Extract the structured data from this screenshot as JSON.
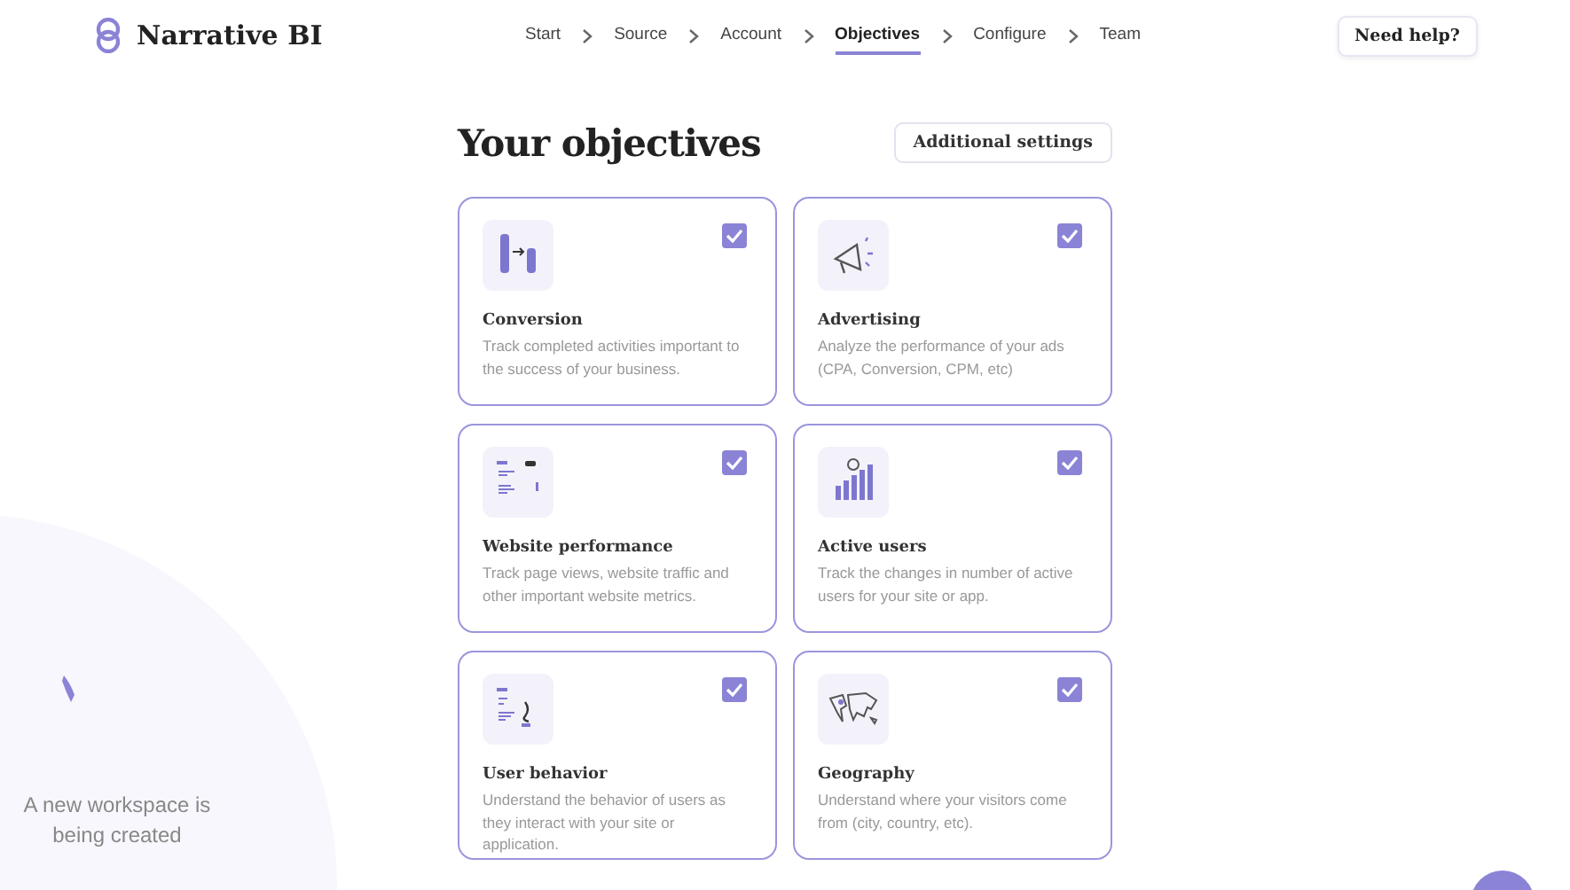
{
  "brand": {
    "name": "Narrative BI"
  },
  "steps": [
    {
      "label": "Start",
      "selected": false
    },
    {
      "label": "Source",
      "selected": false
    },
    {
      "label": "Account",
      "selected": false
    },
    {
      "label": "Objectives",
      "selected": true
    },
    {
      "label": "Configure",
      "selected": false
    },
    {
      "label": "Team",
      "selected": false
    }
  ],
  "help_button": "Need help?",
  "page": {
    "title": "Your objectives",
    "settings_button": "Additional settings"
  },
  "objectives": [
    {
      "title": "Conversion",
      "description": "Track completed activities important to the success of your business.",
      "checked": true
    },
    {
      "title": "Advertising",
      "description": "Analyze the performance of your ads (CPA, Conversion, CPM, etc)",
      "checked": true
    },
    {
      "title": "Website performance",
      "description": "Track page views, website traffic and other important website metrics.",
      "checked": true
    },
    {
      "title": "Active users",
      "description": "Track the changes in number of active users for your site or app.",
      "checked": true
    },
    {
      "title": "User behavior",
      "description": "Understand the behavior of users as they interact with your site or application.",
      "checked": true
    },
    {
      "title": "Geography",
      "description": "Understand where your visitors come from (city, country, etc).",
      "checked": true
    }
  ],
  "workspace_status": "A new workspace is being created"
}
